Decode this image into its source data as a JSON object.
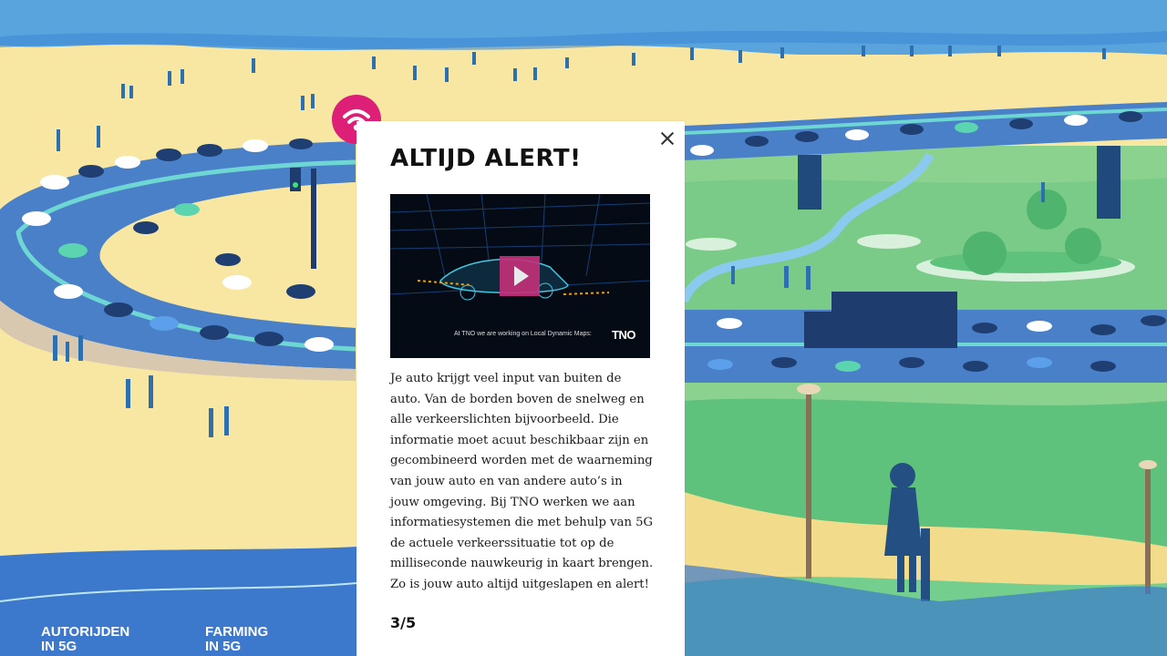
{
  "modal": {
    "title": "ALTIJD ALERT!",
    "video": {
      "caption": "At TNO we are working on Local Dynamic Maps:",
      "logo": "TNO"
    },
    "body": "Je auto krijgt veel input van buiten de auto. Van de borden boven de snelweg en alle verkeerslichten bijvoorbeeld. Die informatie moet acuut beschikbaar zijn en gecombineerd worden met de waarneming van jouw auto en van andere auto’s in jouw omgeving. Bij TNO werken we aan informatiesystemen die met behulp van 5G de actuele verkeerssituatie tot op de milliseconde nauwkeurig in kaart brengen. Zo is jouw auto altijd uitgeslapen en alert!",
    "page_indicator": "3/5"
  },
  "nav": {
    "items": [
      {
        "line1": "AUTORIJDEN",
        "line2": "IN 5G"
      },
      {
        "line1": "FARMING",
        "line2": "IN 5G"
      }
    ]
  },
  "icons": {
    "wifi_button": "wifi-icon",
    "close": "close-icon",
    "play": "play-icon"
  },
  "colors": {
    "accent": "#dd1f78",
    "road": "#4a80c8",
    "sand": "#f7e7a2",
    "grass": "#74cf8e",
    "sea": "#5aa4de"
  }
}
